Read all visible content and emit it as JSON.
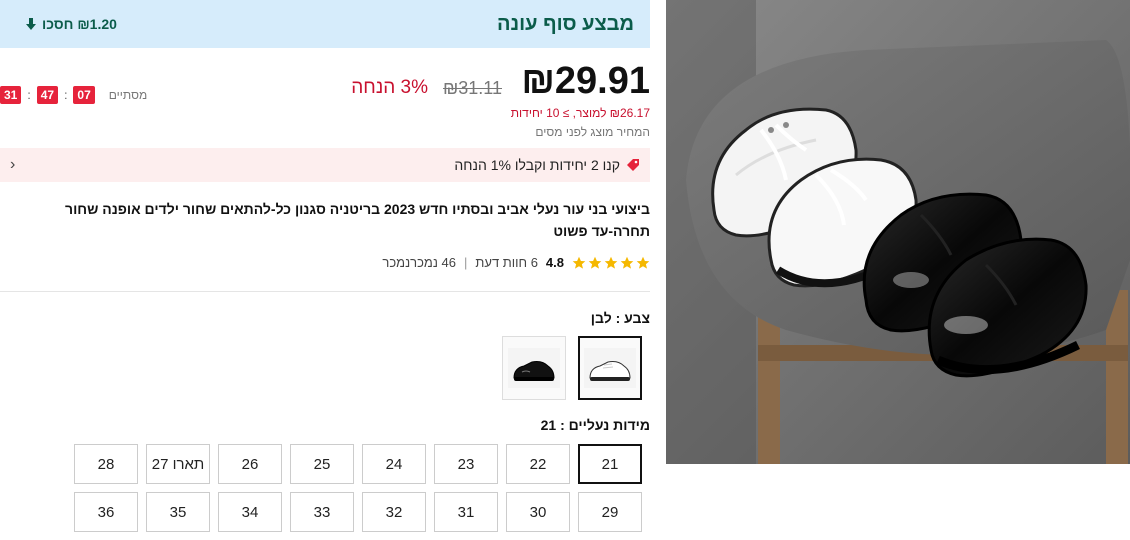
{
  "promo": {
    "title": "מבצע סוף עונה",
    "savings": "₪1.20 חסכו"
  },
  "price": {
    "current": "₪29.91",
    "original": "₪31.11",
    "discount": "3% הנחה",
    "unit_price": "₪26.17 למוצר, ≥ 10 יחידות",
    "tax_note": "המחיר מוצג לפני מסים"
  },
  "countdown": {
    "label": "מסתיים",
    "hours": "07",
    "minutes": "47",
    "seconds": "31"
  },
  "bundle": {
    "text": "קנו 2 יחידות וקבלו 1% הנחה"
  },
  "product": {
    "title": "ביצועי בני עור נעלי אביב ובסתיו חדש 2023 בריטניה סגנון כל-להתאים שחור ילדים אופנה שחור תחרה-עד פשוט",
    "rating": "4.8",
    "rating_value": 4.8,
    "reviews": "6 חוות דעת",
    "sold": "46 נמכרנמכר"
  },
  "color": {
    "label": "צבע : לבן",
    "options": [
      "white",
      "black"
    ],
    "selected": "white"
  },
  "sizes": {
    "label": "מידות נעליים : 21",
    "options": [
      "21",
      "22",
      "23",
      "24",
      "25",
      "26",
      "תארו 27",
      "28",
      "29",
      "30",
      "31",
      "32",
      "33",
      "34",
      "35",
      "36"
    ],
    "selected": "21"
  },
  "colors": {
    "promo_bg": "#d6ecfb",
    "promo_text": "#0b5c4a",
    "accent_red": "#c8102e",
    "star": "#f5b800",
    "bundle_bg": "#fdeeee"
  }
}
